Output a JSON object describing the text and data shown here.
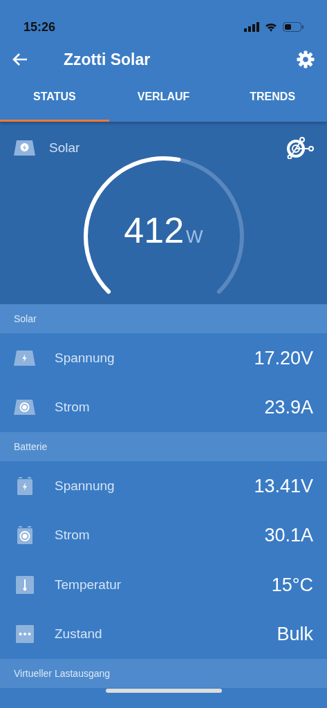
{
  "status_bar": {
    "time": "15:26"
  },
  "app_bar": {
    "title": "Zzotti Solar"
  },
  "tabs": [
    {
      "label": "STATUS",
      "selected": true
    },
    {
      "label": "VERLAUF",
      "selected": false
    },
    {
      "label": "TRENDS",
      "selected": false
    }
  ],
  "gauge": {
    "label": "Solar",
    "value": "412",
    "unit": "W"
  },
  "sections": [
    {
      "title": "Solar",
      "rows": [
        {
          "kind": "panel-bolt",
          "label": "Spannung",
          "value": "17.20V"
        },
        {
          "kind": "panel-dot",
          "label": "Strom",
          "value": "23.9A"
        }
      ]
    },
    {
      "title": "Batterie",
      "rows": [
        {
          "kind": "battery-bolt",
          "label": "Spannung",
          "value": "13.41V"
        },
        {
          "kind": "battery-dot",
          "label": "Strom",
          "value": "30.1A"
        },
        {
          "kind": "thermometer",
          "label": "Temperatur",
          "value": "15°C"
        },
        {
          "kind": "dots",
          "label": "Zustand",
          "value": "Bulk"
        }
      ]
    },
    {
      "title": "Virtueller Lastausgang"
    }
  ]
}
